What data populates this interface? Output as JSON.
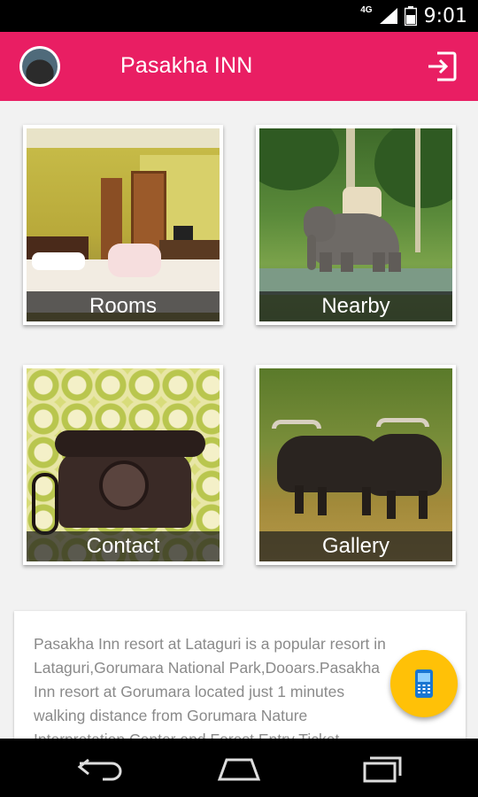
{
  "status_bar": {
    "network_label": "4G",
    "time": "9:01",
    "icons": [
      "signal-icon",
      "battery-icon"
    ]
  },
  "app_bar": {
    "title": "Pasakha INN",
    "background_color": "#E91E63",
    "icons": [
      "avatar",
      "logout-icon"
    ]
  },
  "tiles": [
    {
      "label": "Rooms"
    },
    {
      "label": "Nearby"
    },
    {
      "label": "Contact"
    },
    {
      "label": "Gallery"
    }
  ],
  "description": {
    "lines": [
      "Pasakha Inn resort at Lataguri is a popular resort in",
      "Lataguri,Gorumara National Park,Dooars.Pasakha",
      "Inn resort at Gorumara located just 1 minutes",
      "walking distance from Gorumara Nature",
      "Interpretation Center and Forest Entry Ticket"
    ]
  },
  "fab": {
    "icon": "mobile-phone-icon",
    "color": "#FFC107"
  },
  "nav_bar": {
    "icons": [
      "back-icon",
      "home-icon",
      "recent-apps-icon"
    ]
  }
}
